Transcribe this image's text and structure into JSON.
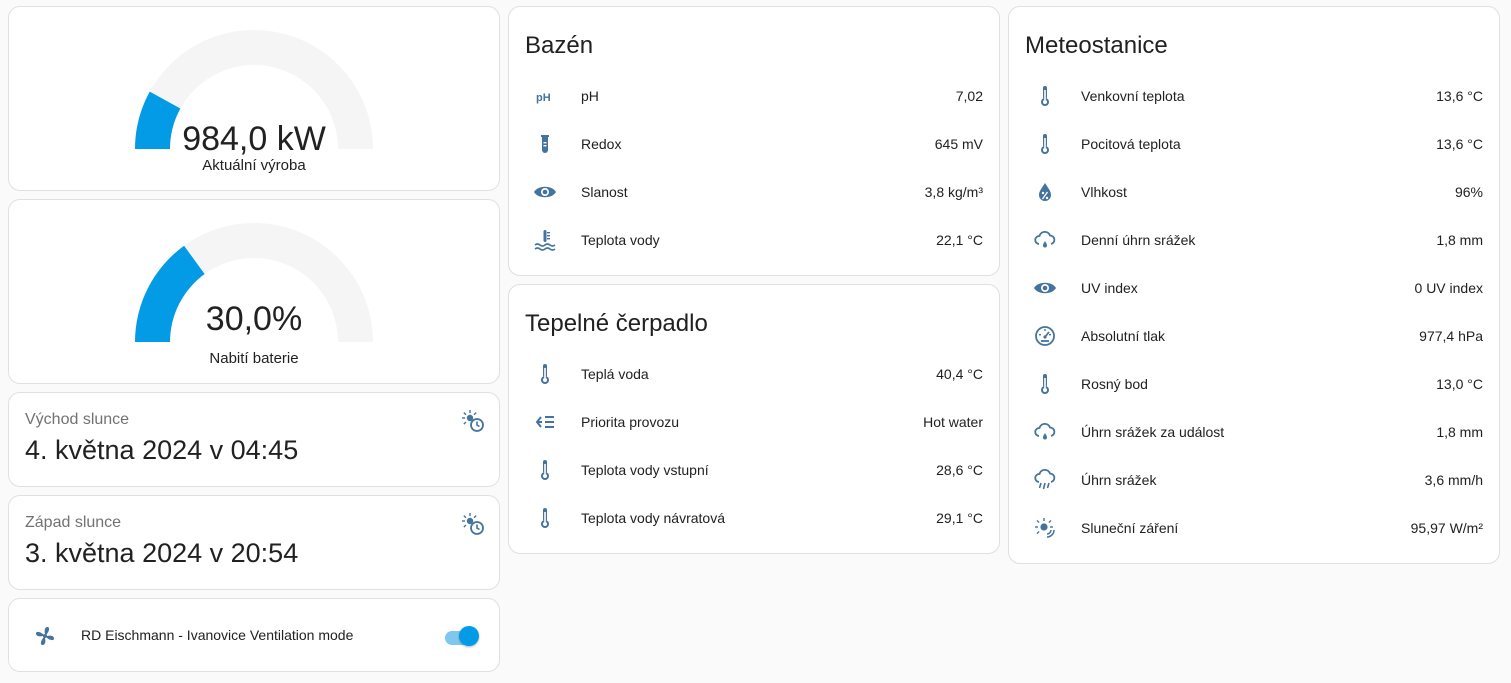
{
  "colors": {
    "accent": "#039be5",
    "icon": "#44739e",
    "track": "#f5f5f5"
  },
  "gauges": [
    {
      "value": "984,0 kW",
      "name": "Aktuální výroba",
      "fraction": 0.16
    },
    {
      "value": "30,0%",
      "name": "Nabití baterie",
      "fraction": 0.3
    }
  ],
  "sun": [
    {
      "label": "Východ slunce",
      "value": "4. května 2024 v 04:45",
      "icon": "sun-clock-icon"
    },
    {
      "label": "Západ slunce",
      "value": "3. května 2024 v 20:54",
      "icon": "sun-clock-icon"
    }
  ],
  "ventilation": {
    "label": "RD Eischmann - Ivanovice Ventilation mode",
    "on": true,
    "icon": "fan-icon"
  },
  "pool": {
    "title": "Bazén",
    "rows": [
      {
        "label": "pH",
        "value": "7,02",
        "icon": "ph-icon"
      },
      {
        "label": "Redox",
        "value": "645 mV",
        "icon": "test-tube-icon"
      },
      {
        "label": "Slanost",
        "value": "3,8 kg/m³",
        "icon": "eye-icon"
      },
      {
        "label": "Teplota vody",
        "value": "22,1 °C",
        "icon": "water-thermometer-icon"
      }
    ]
  },
  "heatpump": {
    "title": "Tepelné čerpadlo",
    "rows": [
      {
        "label": "Teplá voda",
        "value": "40,4 °C",
        "icon": "thermometer-icon"
      },
      {
        "label": "Priorita provozu",
        "value": "Hot water",
        "icon": "priority-list-icon"
      },
      {
        "label": "Teplota vody vstupní",
        "value": "28,6 °C",
        "icon": "thermometer-icon"
      },
      {
        "label": "Teplota vody návratová",
        "value": "29,1 °C",
        "icon": "thermometer-icon"
      }
    ]
  },
  "meteo": {
    "title": "Meteostanice",
    "rows": [
      {
        "label": "Venkovní teplota",
        "value": "13,6 °C",
        "icon": "thermometer-icon"
      },
      {
        "label": "Pocitová teplota",
        "value": "13,6 °C",
        "icon": "thermometer-icon"
      },
      {
        "label": "Vlhkost",
        "value": "96%",
        "icon": "water-percent-icon"
      },
      {
        "label": "Denní úhrn srážek",
        "value": "1,8 mm",
        "icon": "cloud-rain-icon"
      },
      {
        "label": "UV index",
        "value": "0 UV index",
        "icon": "eye-icon"
      },
      {
        "label": "Absolutní tlak",
        "value": "977,4 hPa",
        "icon": "gauge-icon"
      },
      {
        "label": "Rosný bod",
        "value": "13,0 °C",
        "icon": "thermometer-icon"
      },
      {
        "label": "Úhrn srážek za událost",
        "value": "1,8 mm",
        "icon": "cloud-rain-icon"
      },
      {
        "label": "Úhrn srážek",
        "value": "3,6 mm/h",
        "icon": "weather-pouring-icon"
      },
      {
        "label": "Sluneční záření",
        "value": "95,97 W/m²",
        "icon": "sun-wireless-icon"
      }
    ]
  }
}
